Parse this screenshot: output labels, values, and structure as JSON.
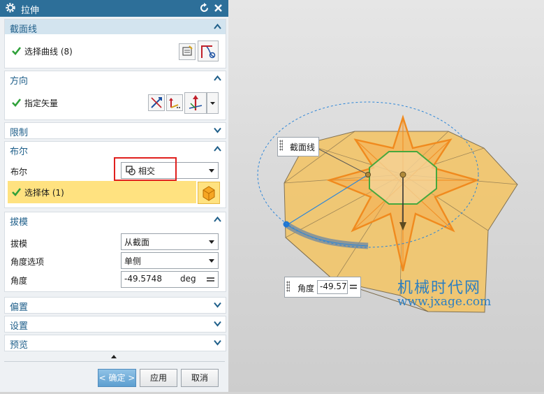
{
  "dialog": {
    "title": "拉伸"
  },
  "sections": {
    "section_curve": {
      "title": "截面线",
      "select_label": "选择曲线 (8)"
    },
    "direction": {
      "title": "方向",
      "vector_label": "指定矢量"
    },
    "limits": {
      "title": "限制"
    },
    "boolean": {
      "title": "布尔",
      "boolean_label": "布尔",
      "boolean_value": "相交",
      "select_body_label": "选择体 (1)"
    },
    "draft": {
      "title": "拔模",
      "draft_label": "拔模",
      "draft_value": "从截面",
      "angle_option_label": "角度选项",
      "angle_option_value": "单侧",
      "angle_label": "角度",
      "angle_value": "-49.5748",
      "angle_unit": "deg"
    },
    "offset": {
      "title": "偏置"
    },
    "settings": {
      "title": "设置"
    },
    "preview": {
      "title": "预览"
    }
  },
  "buttons": {
    "ok": "< 确定 >",
    "apply": "应用",
    "cancel": "取消"
  },
  "viewport": {
    "section_tag": "截面线",
    "angle_tag_label": "角度",
    "angle_tag_value": "-49.57"
  },
  "watermark": {
    "line1": "机械时代网",
    "line2": "www.jxage.com"
  },
  "colors": {
    "title_bar": "#2d6f99",
    "active_header": "#d3e4ef",
    "highlight_row": "#ffe280",
    "model_face": "#f2c66c",
    "model_edge": "#f08a1e",
    "check": "#2fa13a",
    "red_box": "#e0201e"
  },
  "icons": [
    "gear-icon",
    "reset-icon",
    "close-icon",
    "chevron-up-icon",
    "chevron-down-icon",
    "check-icon",
    "curve-select-icon",
    "reverse-direction-icon",
    "vector-dialog-icon",
    "vector-type-icon",
    "intersect-icon",
    "solid-body-icon",
    "equals-icon"
  ]
}
